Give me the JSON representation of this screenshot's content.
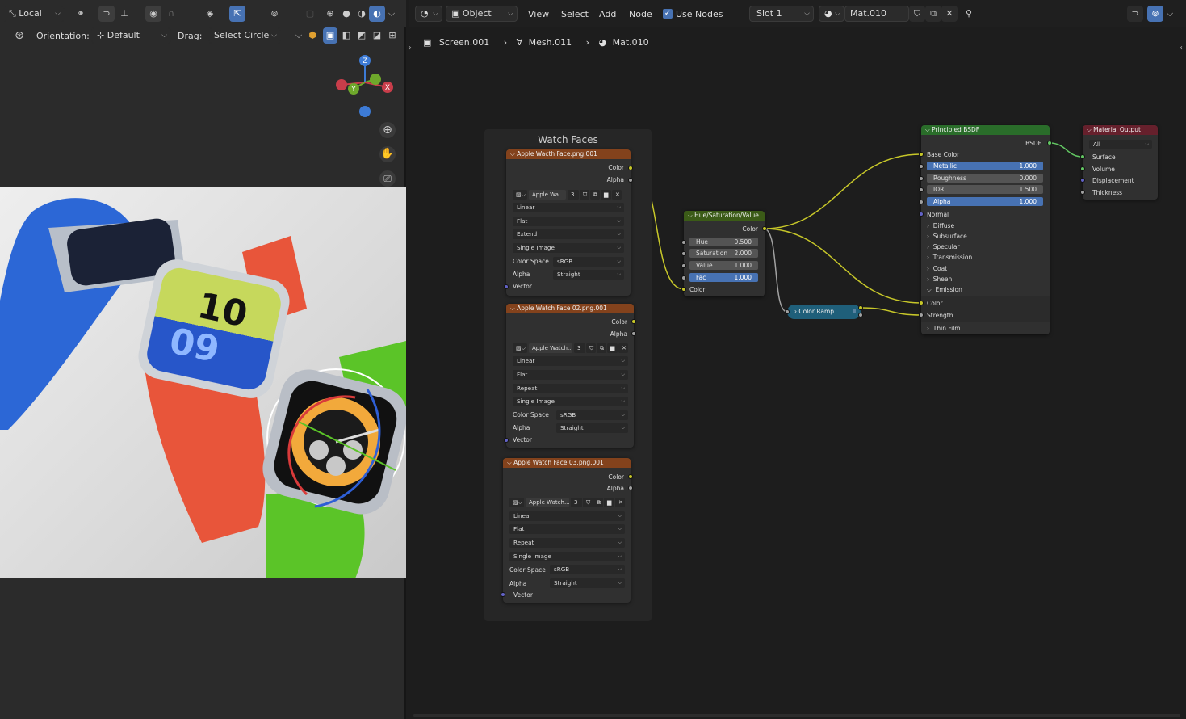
{
  "viewport": {
    "header": {
      "transform_space": "Local",
      "orientation_label": "Orientation:",
      "orientation_value": "Default",
      "drag_label": "Drag:",
      "drag_value": "Select Circle"
    },
    "gizmo": {
      "z": "Z",
      "y": "Y",
      "x": "X"
    }
  },
  "node_editor": {
    "header": {
      "editor_type": "Object",
      "menus": [
        "View",
        "Select",
        "Add",
        "Node"
      ],
      "use_nodes_label": "Use Nodes",
      "slot": "Slot 1",
      "material": "Mat.010"
    },
    "breadcrumb": [
      "Screen.001",
      "Mesh.011",
      "Mat.010"
    ],
    "frame_title": "Watch Faces",
    "image_nodes": [
      {
        "title": "Apple Wacth Face.png.001",
        "out_color": "Color",
        "out_alpha": "Alpha",
        "image": "Apple Wa...",
        "users": "3",
        "interpolation": "Linear",
        "projection": "Flat",
        "extension": "Extend",
        "source": "Single Image",
        "colorspace_label": "Color Space",
        "colorspace": "sRGB",
        "alpha_label": "Alpha",
        "alpha": "Straight",
        "vector": "Vector"
      },
      {
        "title": "Apple Watch Face 02.png.001",
        "out_color": "Color",
        "out_alpha": "Alpha",
        "image": "Apple Watch...",
        "users": "3",
        "interpolation": "Linear",
        "projection": "Flat",
        "extension": "Repeat",
        "source": "Single Image",
        "colorspace_label": "Color Space",
        "colorspace": "sRGB",
        "alpha_label": "Alpha",
        "alpha": "Straight",
        "vector": "Vector"
      },
      {
        "title": "Apple Watch Face 03.png.001",
        "out_color": "Color",
        "out_alpha": "Alpha",
        "image": "Apple Watch...",
        "users": "3",
        "interpolation": "Linear",
        "projection": "Flat",
        "extension": "Repeat",
        "source": "Single Image",
        "colorspace_label": "Color Space",
        "colorspace": "sRGB",
        "alpha_label": "Alpha",
        "alpha": "Straight",
        "vector": "Vector"
      }
    ],
    "hsv": {
      "title": "Hue/Saturation/Value",
      "out": "Color",
      "hue": "Hue",
      "hue_v": "0.500",
      "sat": "Saturation",
      "sat_v": "2.000",
      "val": "Value",
      "val_v": "1.000",
      "fac": "Fac",
      "fac_v": "1.000",
      "in_color": "Color"
    },
    "ramp": {
      "title": "Color Ramp"
    },
    "bsdf": {
      "title": "Principled BSDF",
      "out": "BSDF",
      "base_color": "Base Color",
      "metallic": "Metallic",
      "metallic_v": "1.000",
      "roughness": "Roughness",
      "roughness_v": "0.000",
      "ior": "IOR",
      "ior_v": "1.500",
      "alpha": "Alpha",
      "alpha_v": "1.000",
      "normal": "Normal",
      "panels": [
        "Diffuse",
        "Subsurface",
        "Specular",
        "Transmission",
        "Coat",
        "Sheen"
      ],
      "emission": "Emission",
      "em_color": "Color",
      "em_strength": "Strength",
      "thin_film": "Thin Film"
    },
    "output": {
      "title": "Material Output",
      "target": "All",
      "surface": "Surface",
      "volume": "Volume",
      "displacement": "Displacement",
      "thickness": "Thickness"
    }
  },
  "colors": {
    "image_header": "#83421c",
    "hsv_header": "#3b5b17",
    "bsdf_header": "#2a6d2a",
    "output_header": "#66202c",
    "ramp": "#1f5f7a",
    "link": "#c7c729"
  }
}
